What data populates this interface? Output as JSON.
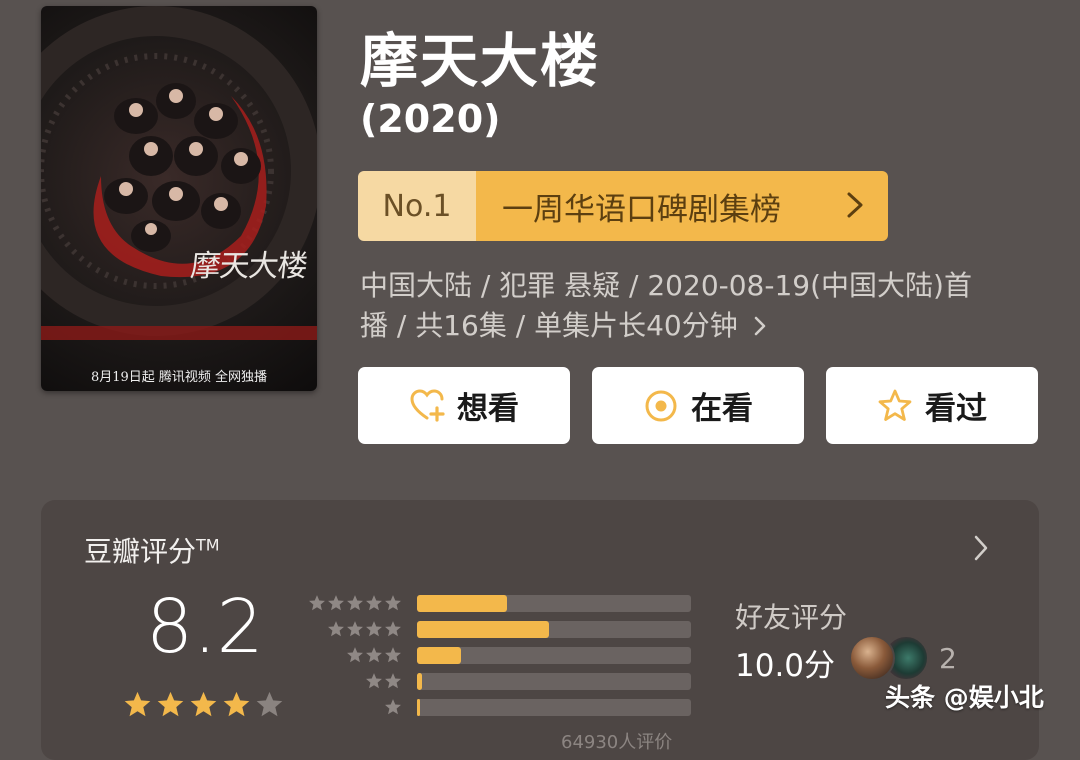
{
  "poster": {
    "title_art": "摩天大楼",
    "release_line": "8月19日起 腾讯视频 全网独播"
  },
  "title": "摩天大楼",
  "year": "(2020)",
  "rank": {
    "number": "No.1",
    "label": "一周华语口碑剧集榜"
  },
  "meta_line1": "中国大陆 / 犯罪 悬疑 / 2020-08-19(中国大陆)首",
  "meta_line2": "播 / 共16集 / 单集片长40分钟",
  "actions": {
    "want": "想看",
    "watching": "在看",
    "watched": "看过"
  },
  "rating": {
    "label": "豆瓣评分",
    "trademark": "TM",
    "score": "8.2",
    "stars_filled": 4,
    "distribution": [
      {
        "stars": 5,
        "fraction": 0.33
      },
      {
        "stars": 4,
        "fraction": 0.48
      },
      {
        "stars": 3,
        "fraction": 0.16
      },
      {
        "stars": 2,
        "fraction": 0.02
      },
      {
        "stars": 1,
        "fraction": 0.01
      }
    ],
    "total_partial": "64930人评价"
  },
  "friends": {
    "label": "好友评分",
    "score": "10.0分",
    "count": "2"
  },
  "watermark": "头条 @娱小北",
  "colors": {
    "background": "#585250",
    "accent_gold": "#f3b84b",
    "rank_number_bg": "#f6d9a3",
    "card_bg": "#4d4644",
    "star_empty": "#8a8380"
  }
}
